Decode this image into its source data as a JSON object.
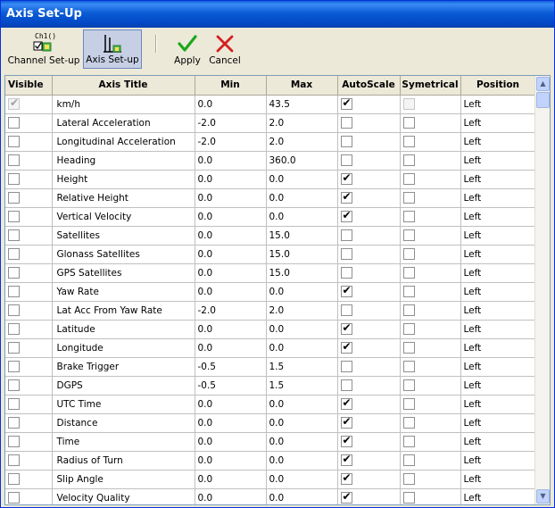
{
  "window": {
    "title": "Axis Set-Up"
  },
  "toolbar": {
    "channel_setup_label": "Channel Set-up",
    "channel_setup_icon_text": "Ch1()",
    "axis_setup_label": "Axis Set-up",
    "apply_label": "Apply",
    "cancel_label": "Cancel"
  },
  "colors": {
    "apply_green": "#1aa81a",
    "cancel_red": "#d42020",
    "titlebar_blue": "#0b5cd6"
  },
  "table": {
    "headers": [
      "Visible",
      "Axis Title",
      "Min",
      "Max",
      "AutoScale",
      "Symetrical",
      "Position"
    ],
    "rows": [
      {
        "visible": true,
        "visible_disabled": true,
        "title": "km/h",
        "min": "0.0",
        "max": "43.5",
        "autoscale": true,
        "symetrical": false,
        "symetrical_disabled": true,
        "position": "Left"
      },
      {
        "visible": false,
        "title": "Lateral Acceleration",
        "min": "-2.0",
        "max": "2.0",
        "autoscale": false,
        "symetrical": false,
        "position": "Left"
      },
      {
        "visible": false,
        "title": "Longitudinal Acceleration",
        "min": "-2.0",
        "max": "2.0",
        "autoscale": false,
        "symetrical": false,
        "position": "Left"
      },
      {
        "visible": false,
        "title": "Heading",
        "min": "0.0",
        "max": "360.0",
        "autoscale": false,
        "symetrical": false,
        "position": "Left"
      },
      {
        "visible": false,
        "title": "Height",
        "min": "0.0",
        "max": "0.0",
        "autoscale": true,
        "symetrical": false,
        "position": "Left"
      },
      {
        "visible": false,
        "title": "Relative Height",
        "min": "0.0",
        "max": "0.0",
        "autoscale": true,
        "symetrical": false,
        "position": "Left"
      },
      {
        "visible": false,
        "title": "Vertical Velocity",
        "min": "0.0",
        "max": "0.0",
        "autoscale": true,
        "symetrical": false,
        "position": "Left"
      },
      {
        "visible": false,
        "title": "Satellites",
        "min": "0.0",
        "max": "15.0",
        "autoscale": false,
        "symetrical": false,
        "position": "Left"
      },
      {
        "visible": false,
        "title": "Glonass Satellites",
        "min": "0.0",
        "max": "15.0",
        "autoscale": false,
        "symetrical": false,
        "position": "Left"
      },
      {
        "visible": false,
        "title": "GPS Satellites",
        "min": "0.0",
        "max": "15.0",
        "autoscale": false,
        "symetrical": false,
        "position": "Left"
      },
      {
        "visible": false,
        "title": "Yaw Rate",
        "min": "0.0",
        "max": "0.0",
        "autoscale": true,
        "symetrical": false,
        "position": "Left"
      },
      {
        "visible": false,
        "title": "Lat Acc From Yaw Rate",
        "min": "-2.0",
        "max": "2.0",
        "autoscale": false,
        "symetrical": false,
        "position": "Left"
      },
      {
        "visible": false,
        "title": "Latitude",
        "min": "0.0",
        "max": "0.0",
        "autoscale": true,
        "symetrical": false,
        "position": "Left"
      },
      {
        "visible": false,
        "title": "Longitude",
        "min": "0.0",
        "max": "0.0",
        "autoscale": true,
        "symetrical": false,
        "position": "Left"
      },
      {
        "visible": false,
        "title": "Brake Trigger",
        "min": "-0.5",
        "max": "1.5",
        "autoscale": false,
        "symetrical": false,
        "position": "Left"
      },
      {
        "visible": false,
        "title": "DGPS",
        "min": "-0.5",
        "max": "1.5",
        "autoscale": false,
        "symetrical": false,
        "position": "Left"
      },
      {
        "visible": false,
        "title": "UTC Time",
        "min": "0.0",
        "max": "0.0",
        "autoscale": true,
        "symetrical": false,
        "position": "Left"
      },
      {
        "visible": false,
        "title": "Distance",
        "min": "0.0",
        "max": "0.0",
        "autoscale": true,
        "symetrical": false,
        "position": "Left"
      },
      {
        "visible": false,
        "title": "Time",
        "min": "0.0",
        "max": "0.0",
        "autoscale": true,
        "symetrical": false,
        "position": "Left"
      },
      {
        "visible": false,
        "title": "Radius of Turn",
        "min": "0.0",
        "max": "0.0",
        "autoscale": true,
        "symetrical": false,
        "position": "Left"
      },
      {
        "visible": false,
        "title": "Slip Angle",
        "min": "0.0",
        "max": "0.0",
        "autoscale": true,
        "symetrical": false,
        "position": "Left"
      },
      {
        "visible": false,
        "title": "Velocity Quality",
        "min": "0.0",
        "max": "0.0",
        "autoscale": true,
        "symetrical": false,
        "position": "Left"
      }
    ]
  }
}
